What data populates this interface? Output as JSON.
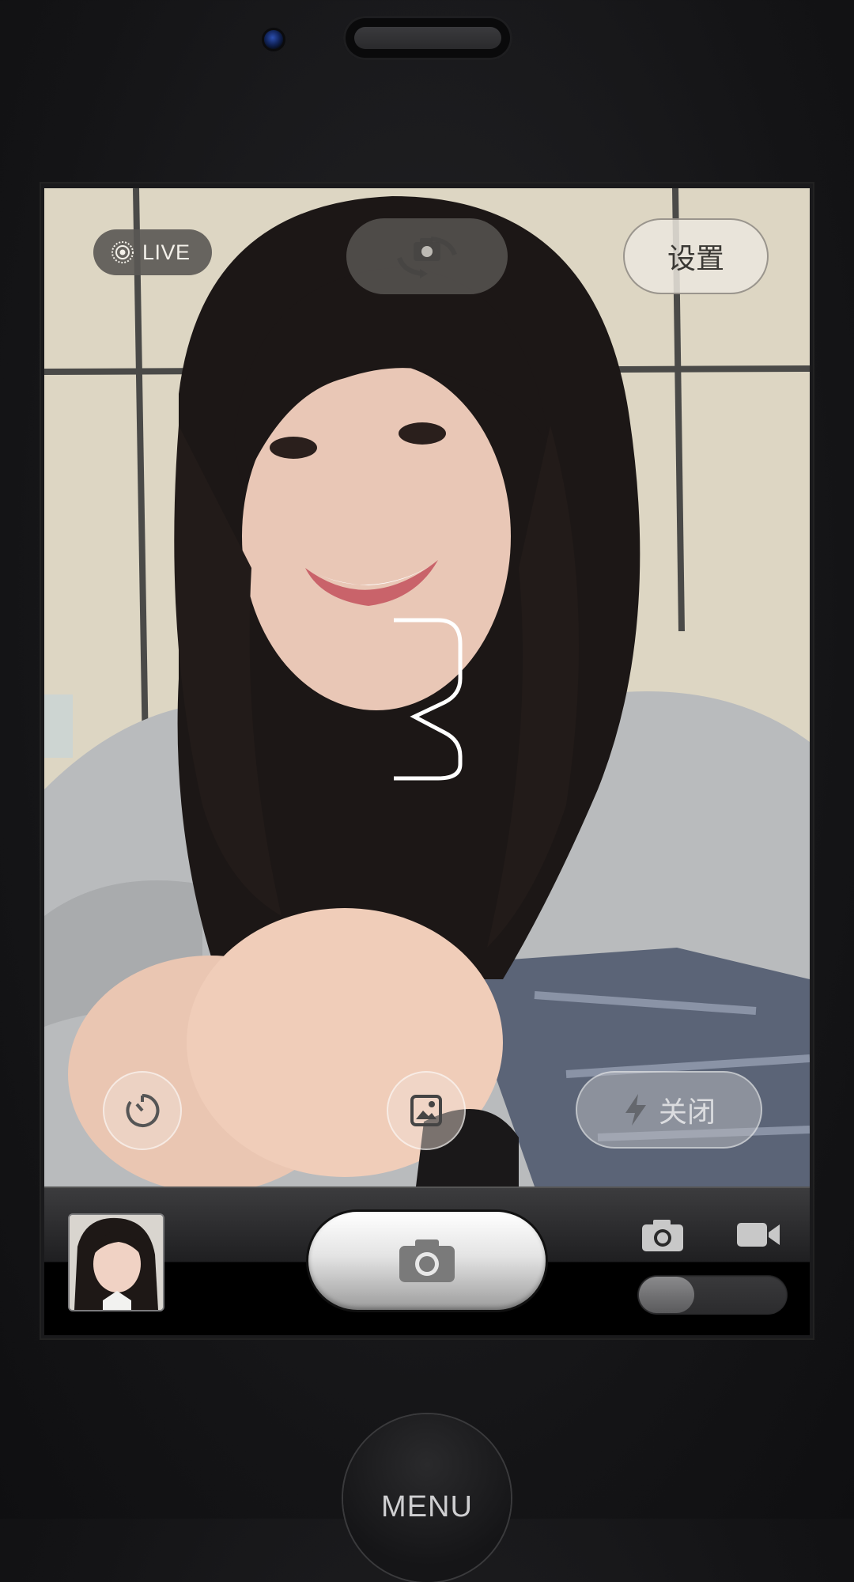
{
  "top_bar": {
    "live_label": "LIVE",
    "settings_label": "设置"
  },
  "icons": {
    "live": "live-photo-icon",
    "flip": "camera-flip-icon",
    "timer": "timer-icon",
    "gallery": "gallery-icon",
    "flash": "flash-icon",
    "shutter": "camera-icon",
    "photo_mode": "photo-mode-icon",
    "video_mode": "video-mode-icon"
  },
  "countdown": {
    "value": "3"
  },
  "flash": {
    "label": "关闭"
  },
  "mode_toggle": {
    "selected": "photo"
  },
  "hardware": {
    "menu_label": "MENU"
  },
  "colors": {
    "accent": "#ffffff",
    "bar_dark": "#000000",
    "pill_bg": "#5a5854"
  }
}
